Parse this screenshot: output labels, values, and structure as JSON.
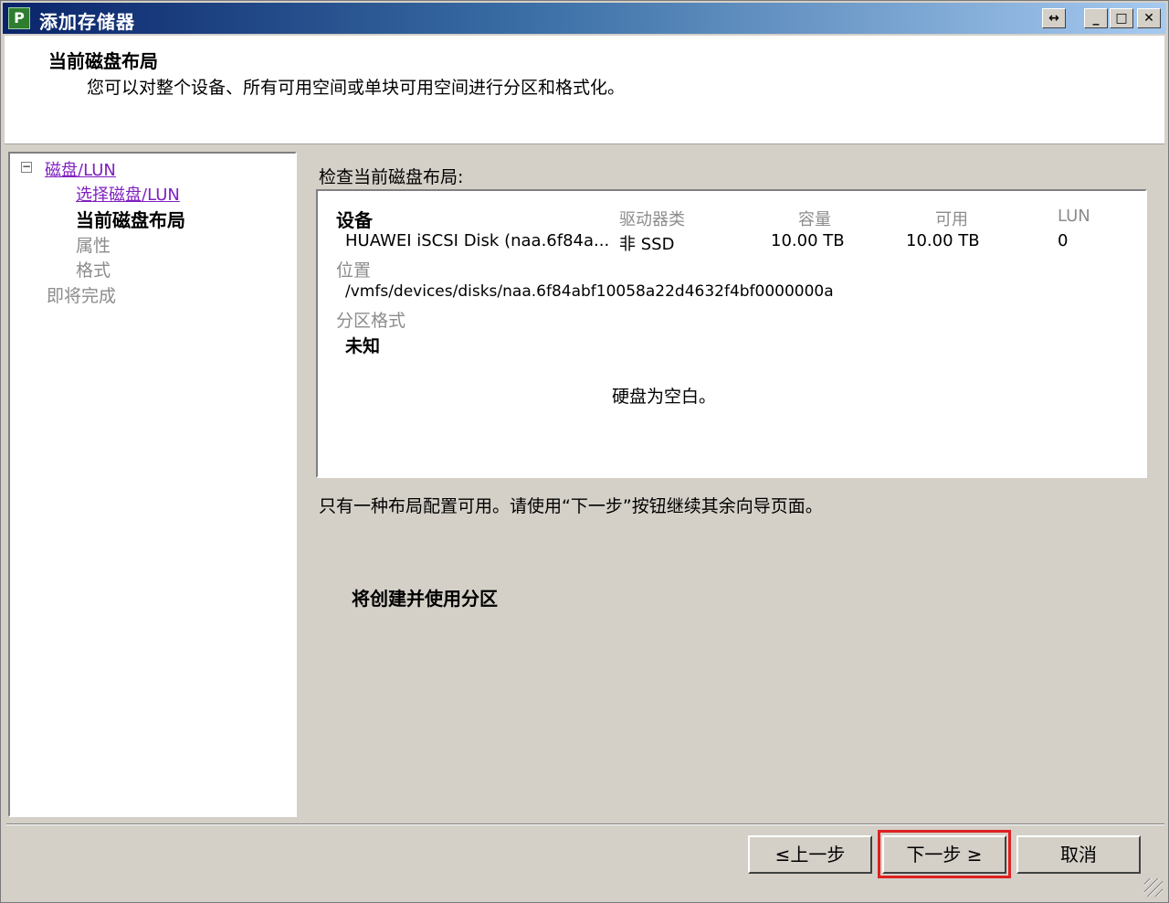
{
  "window": {
    "title": "添加存储器"
  },
  "titlebar_buttons": {
    "restore": "↔",
    "minimize": "_",
    "maximize": "□",
    "close": "✕"
  },
  "header": {
    "title": "当前磁盘布局",
    "description": "您可以对整个设备、所有可用空间或单块可用空间进行分区和格式化。"
  },
  "nav": {
    "items": [
      {
        "label": "磁盘/LUN",
        "state": "link"
      },
      {
        "label": "选择磁盘/LUN",
        "state": "link"
      },
      {
        "label": "当前磁盘布局",
        "state": "current"
      },
      {
        "label": "属性",
        "state": "disabled"
      },
      {
        "label": "格式",
        "state": "disabled"
      },
      {
        "label": "即将完成",
        "state": "disabled"
      }
    ],
    "tree_toggle": "−"
  },
  "content": {
    "section_label": "检查当前磁盘布局:",
    "columns": {
      "device": "设备",
      "drive_type": "驱动器类",
      "capacity": "容量",
      "available": "可用",
      "lun": "LUN"
    },
    "row": {
      "device": "HUAWEI iSCSI Disk (naa.6f84a...",
      "drive_type": "非 SSD",
      "capacity": "10.00 TB",
      "available": "10.00 TB",
      "lun": "0"
    },
    "location_label": "位置",
    "location_value": "/vmfs/devices/disks/naa.6f84abf10058a22d4632f4bf0000000a",
    "partition_format_label": "分区格式",
    "partition_format_value": "未知",
    "empty_message": "硬盘为空白。",
    "info_text": "只有一种布局配置可用。请使用“下一步”按钮继续其余向导页面。",
    "partition_note": "将创建并使用分区"
  },
  "footer": {
    "back_label": "≤上一步",
    "next_label": "下一步 ≥",
    "cancel_label": "取消"
  },
  "colors": {
    "highlight": "#e02020",
    "link": "#8020c0",
    "title_bar": "#0a246a"
  }
}
